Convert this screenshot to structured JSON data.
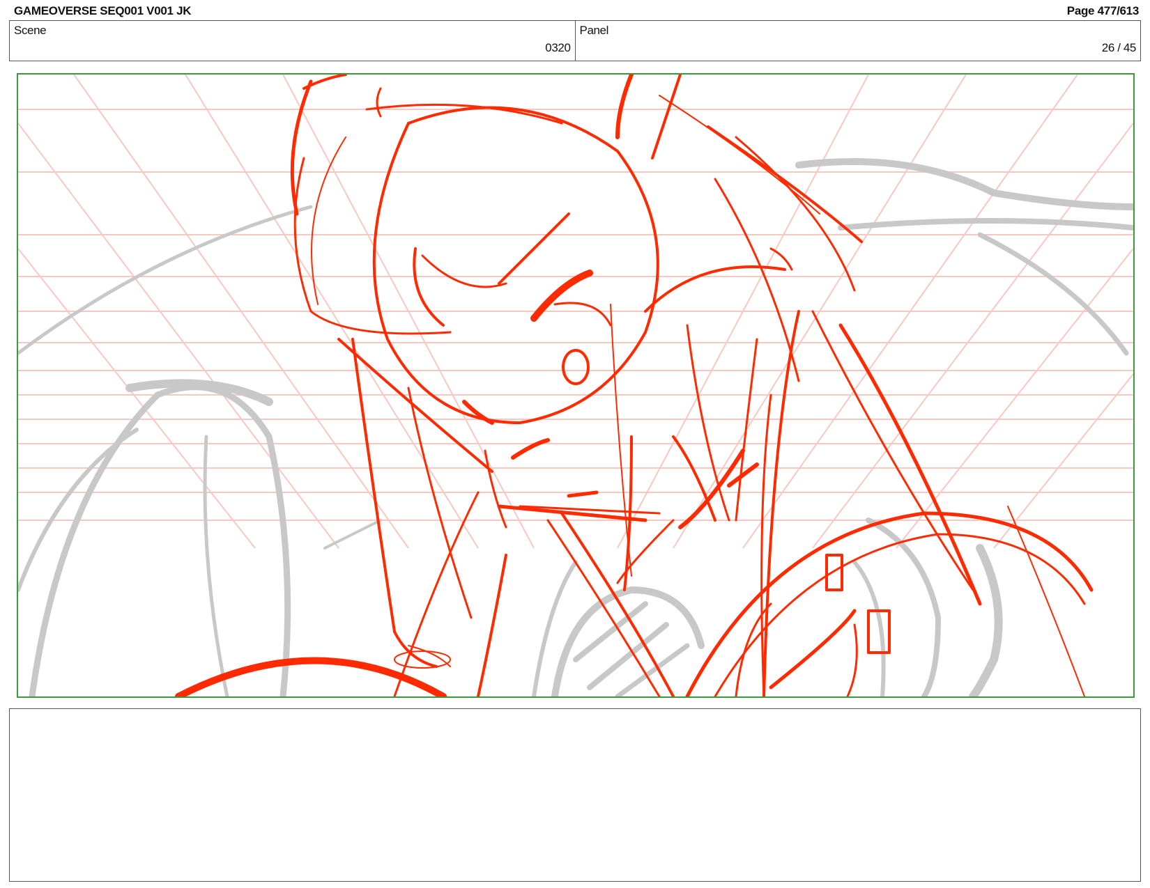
{
  "header": {
    "title": "GAMEOVERSE SEQ001 V001 JK",
    "page": "Page 477/613"
  },
  "info": {
    "scene_label": "Scene",
    "scene_value": "0320",
    "panel_label": "Panel",
    "panel_value": "26 / 45"
  },
  "colors": {
    "sketch_red": "#ff2a00",
    "grid_pink": "#f8c8c0",
    "rough_gray": "#c8c8c8",
    "frame_green": "#3a9a3a"
  }
}
